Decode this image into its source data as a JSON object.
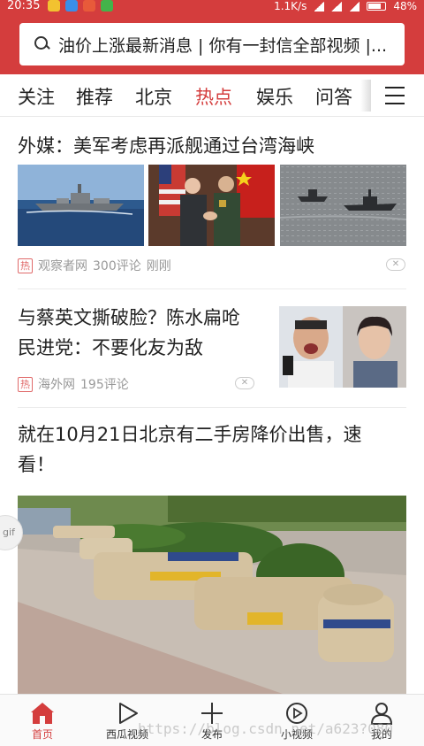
{
  "status_bar": {
    "time": "20:35",
    "network_speed": "1.1K/s",
    "battery": "48%"
  },
  "search": {
    "text": "油价上涨最新消息 | 你有一封信全部视频 |..."
  },
  "channels": {
    "items": [
      {
        "label": "关注"
      },
      {
        "label": "推荐"
      },
      {
        "label": "北京"
      },
      {
        "label": "热点",
        "active": true
      },
      {
        "label": "娱乐"
      },
      {
        "label": "问答"
      }
    ]
  },
  "feed": {
    "items": [
      {
        "title": "外媒：美军考虑再派舰通过台湾海峡",
        "badge": "热",
        "source": "观察者网",
        "comments": "300评论",
        "time": "刚刚"
      },
      {
        "title_line1": "与蔡英文撕破脸？陈水扁呛",
        "title_line2": "民进党：不要化友为敌",
        "badge": "热",
        "source": "海外网",
        "comments": "195评论"
      },
      {
        "title_line1": "就在10月21日北京有二手房降价出售，速",
        "title_line2": "看！"
      }
    ],
    "gif_label": "gif"
  },
  "bottom_nav": {
    "items": [
      {
        "label": "首页",
        "icon": "home-icon",
        "active": true
      },
      {
        "label": "西瓜视频",
        "icon": "play-icon"
      },
      {
        "label": "发布",
        "icon": "plus-icon"
      },
      {
        "label": "小视频",
        "icon": "small-video-icon"
      },
      {
        "label": "我的",
        "icon": "person-icon"
      }
    ]
  },
  "watermark": "https://blog.csdn.net/a623?080",
  "colors": {
    "brand_red": "#d43d3d",
    "meta_gray": "#999999"
  }
}
